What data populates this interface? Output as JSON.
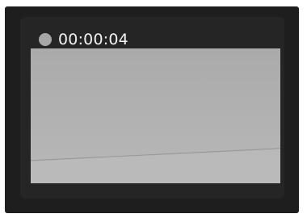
{
  "recording": {
    "indicator_icon": "record-dot-icon",
    "indicator_color": "#a6a6a6",
    "elapsed_time": "00:00:04"
  }
}
